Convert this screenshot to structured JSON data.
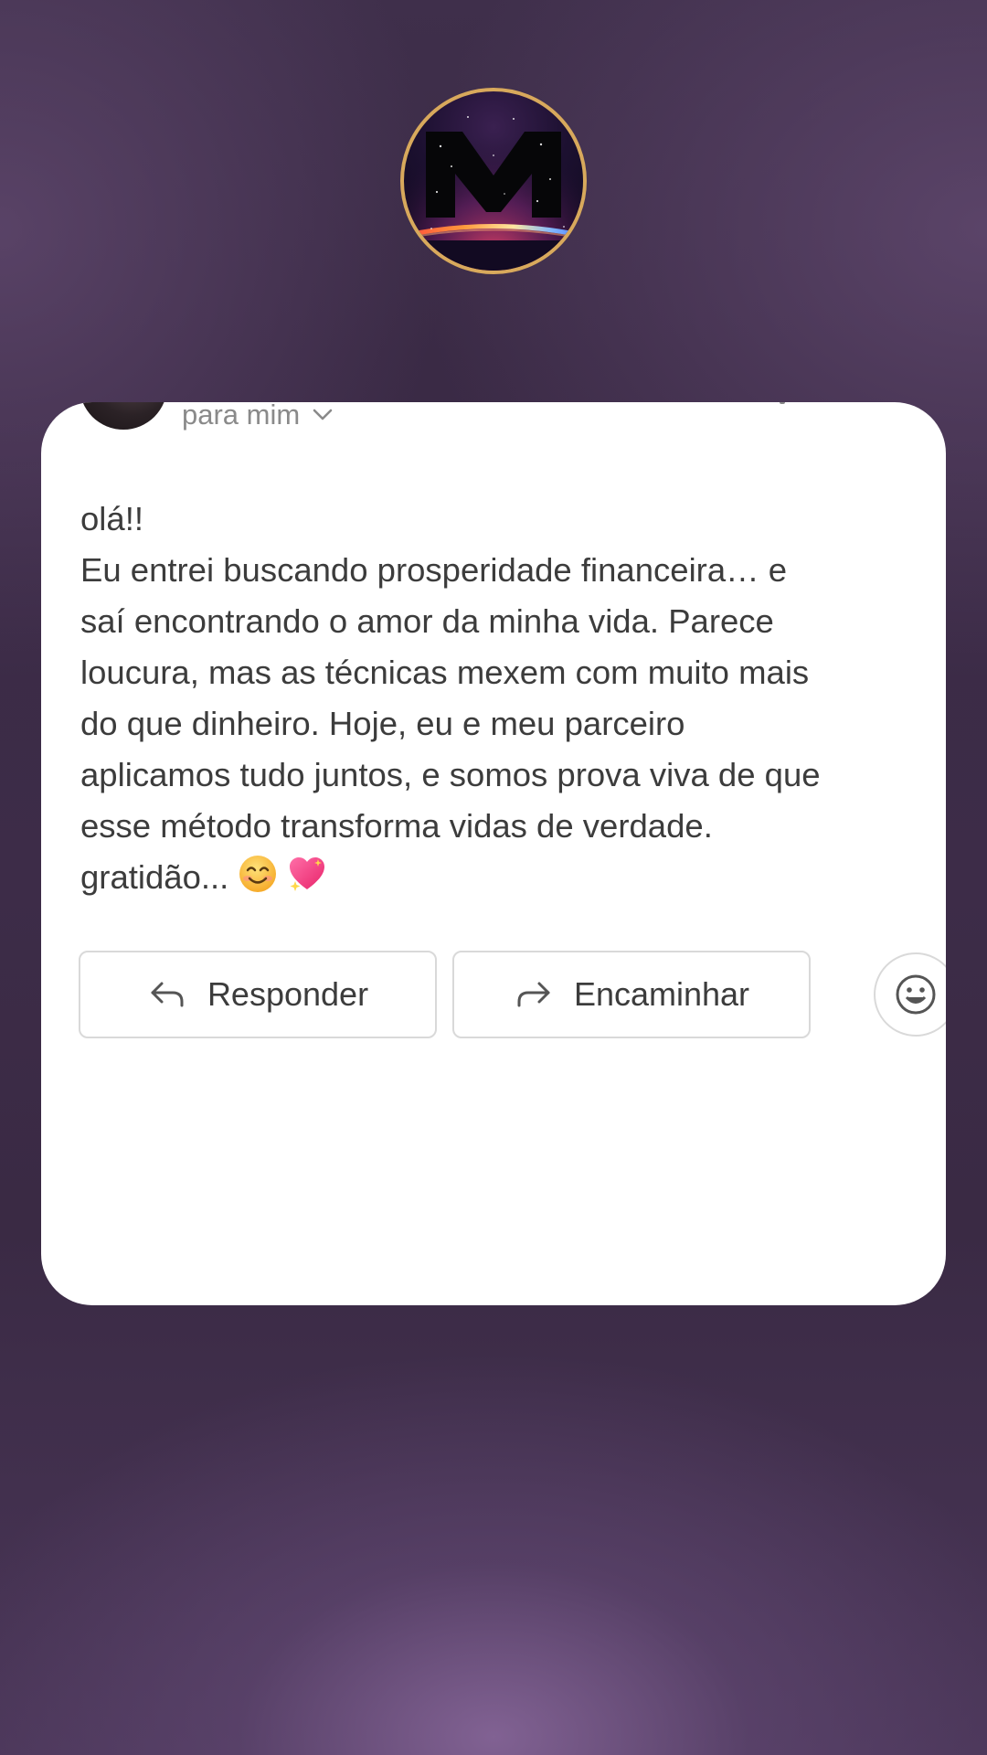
{
  "header": {
    "logo_icon": "m-galaxy-logo-icon"
  },
  "email": {
    "recipient_label": "para mim",
    "body_lines": [
      "olá!!",
      "Eu entrei buscando prosperidade financeira… e",
      "saí encontrando o amor da minha vida. Parece",
      "loucura, mas as técnicas mexem com muito mais",
      "do que dinheiro. Hoje, eu e meu parceiro",
      "aplicamos tudo juntos, e somos prova viva de que",
      "esse método transforma vidas de verdade.",
      "gratidão..."
    ],
    "closing_emojis": [
      "smiling-face-emoji",
      "sparkling-heart-emoji"
    ]
  },
  "actions": {
    "reply_label": "Responder",
    "forward_label": "Encaminhar",
    "reply_icon": "reply-arrow-icon",
    "forward_icon": "forward-arrow-icon",
    "emoji_icon": "smiley-face-icon"
  },
  "colors": {
    "logo_border": "#d8a95c",
    "text": "#3c3c3c",
    "muted_text": "#8a8a8a",
    "button_border": "#d9d9d9"
  }
}
